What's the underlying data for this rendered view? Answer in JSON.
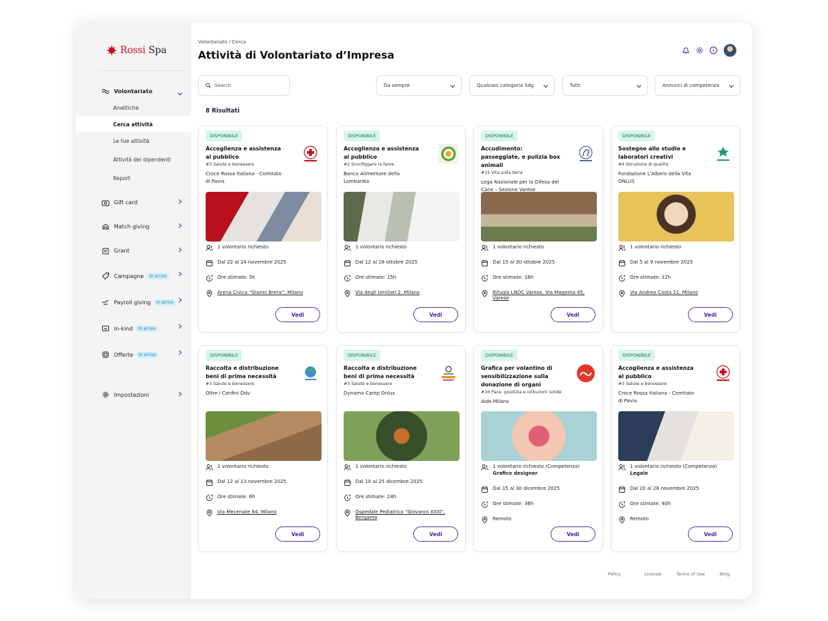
{
  "brand": {
    "name_red": "Rossi",
    "name_dark": "Spa"
  },
  "sidebar": {
    "volontariato": {
      "label": "Volontariato",
      "items": [
        "Analitiche",
        "Cerca attività",
        "Le tue attività",
        "Attività dei dipendenti",
        "Report"
      ],
      "active_index": 1
    },
    "items": [
      {
        "label": "Gift card",
        "icon": "gift-card-icon",
        "badge": ""
      },
      {
        "label": "Match giving",
        "icon": "match-giving-icon",
        "badge": ""
      },
      {
        "label": "Grant",
        "icon": "grant-icon",
        "badge": ""
      },
      {
        "label": "Campagne",
        "icon": "tag-icon",
        "badge": "In arrivo"
      },
      {
        "label": "Payroll giving",
        "icon": "payroll-icon",
        "badge": "In arrivo"
      },
      {
        "label": "In-kind",
        "icon": "in-kind-icon",
        "badge": "In arrivo"
      },
      {
        "label": "Offerte",
        "icon": "offers-icon",
        "badge": "In arrivo"
      }
    ],
    "settings": "Impostazioni"
  },
  "header": {
    "breadcrumb": "Volontariato / Cerca",
    "title": "Attività di Volontariato d’Impresa"
  },
  "filters": {
    "search_placeholder": "Search",
    "period": "Da sempre",
    "sdg": "Qualsiasi categoria Sdg",
    "type": "Tutti",
    "competence": "Annunci di competenza"
  },
  "results_count": "8 Risultati",
  "cards": [
    {
      "status": "DISPONIBILE",
      "title": "Accoglienza e assistenza al pubblico",
      "sdg": "#3 Salute e benessere",
      "org": "Croce Rossa Italiana - Comitato di Pavia",
      "logo": "red-cross",
      "req": "1 volontario richiesto",
      "role": "",
      "dates": "Dal 22 al 24 novembre 2025",
      "hours": "Ore stimate: 5h",
      "place": "Arena Civica “Gianni Brera”, Milano",
      "remote": false,
      "img": "img1",
      "cta": "Vedi"
    },
    {
      "status": "DISPONIBILE",
      "title": "Accoglienza e assistenza al pubblico",
      "sdg": "#2 Sconfiggere la fame",
      "org": "Banco Alimentare della Lombardia",
      "logo": "banco",
      "req": "1 volontario richiesto",
      "role": "",
      "dates": "Dal 12 al 18 ottobre 2025",
      "hours": "Ore stimate: 15h",
      "place": "Via degli Umiliati 2, Milano",
      "remote": false,
      "img": "img2",
      "cta": "Vedi"
    },
    {
      "status": "DISPONIBILE",
      "title": "Accudimento: passeggiate, e pulizia box animali",
      "sdg": "#15 Vita sulla terra",
      "org": "Lega Nazionale per la Difesa del Cane – Sezione Varese",
      "logo": "lndc",
      "req": "1 volontario richiesto",
      "role": "",
      "dates": "Dal 15 al 30 ottobre 2025",
      "hours": "Ore stimate: 16h",
      "place": "Rifugio LNDC Varese, Via Magenta 45, Varese",
      "remote": false,
      "img": "img3",
      "cta": "Vedi"
    },
    {
      "status": "DISPONIBILE",
      "title": "Sostegno allo studio e laboratori creativi",
      "sdg": "#4 Istruzione di qualità",
      "org": "Fondazione L'Albero della Vita ONLUS",
      "logo": "albero",
      "req": "1 volontario richiesto",
      "role": "",
      "dates": "Dal 5 al 9 novembre 2025",
      "hours": "Ore stimate: 12h",
      "place": "Via Andrea Costa 21, Milano",
      "remote": false,
      "img": "img4",
      "cta": "Vedi"
    },
    {
      "status": "DISPONIBILE",
      "title": "Raccolta e distribuzione beni di prima necessità",
      "sdg": "#3 Salute e benessere",
      "org": "Oltre i Confini Odv",
      "logo": "oltre",
      "req": "1 volontario richiesto",
      "role": "",
      "dates": "Dal 12 al 13 novembre 2025",
      "hours": "Ore stimate: 6h",
      "place": "Via Mecenate 84, Milano",
      "remote": false,
      "img": "img5",
      "cta": "Vedi"
    },
    {
      "status": "DISPONIBILE",
      "title": "Raccolta e distribuzione beni di prima necessità",
      "sdg": "#3 Salute e benessere",
      "org": "Dynamo Camp Onlus",
      "logo": "dynamo",
      "req": "1 volontario richiesto",
      "role": "",
      "dates": "Dal 10 al 25 dicembre 2025",
      "hours": "Ore stimate: 24h",
      "place": "Ospedale Pediatrico “Giovanni XXIII”, Bergamo",
      "remote": false,
      "img": "img6",
      "cta": "Vedi"
    },
    {
      "status": "DISPONIBILE",
      "title": "Grafica per volantino di sensibilizzazione sulla donazione di organi",
      "sdg": "#16 Pace, giustizia e istituzioni solide",
      "org": "Aido Milano",
      "logo": "aido",
      "req": "1 volontario richiesto (Competenza)",
      "role": "Grafico designer",
      "dates": "Dal 15 al 30 dicembre 2025",
      "hours": "Ore stimate: 36h",
      "place": "Remoto",
      "remote": true,
      "img": "img7",
      "cta": "Vedi"
    },
    {
      "status": "DISPONIBILE",
      "title": "Accoglienza e assistenza al pubblico",
      "sdg": "#3 Salute e benessere",
      "org": "Croce Rossa Italiana - Comitato di Pavia",
      "logo": "red-cross",
      "req": "1 volontario richiesto (Competenza)",
      "role": "Legale",
      "dates": "Dal 20 al 28 novembre 2025",
      "hours": "Ore stimate: 40h",
      "place": "Remoto",
      "remote": true,
      "img": "img8",
      "cta": "Vedi"
    }
  ],
  "footer": {
    "policy": "Policy",
    "license": "License",
    "terms": "Terms of Use",
    "blog": "Blog"
  }
}
